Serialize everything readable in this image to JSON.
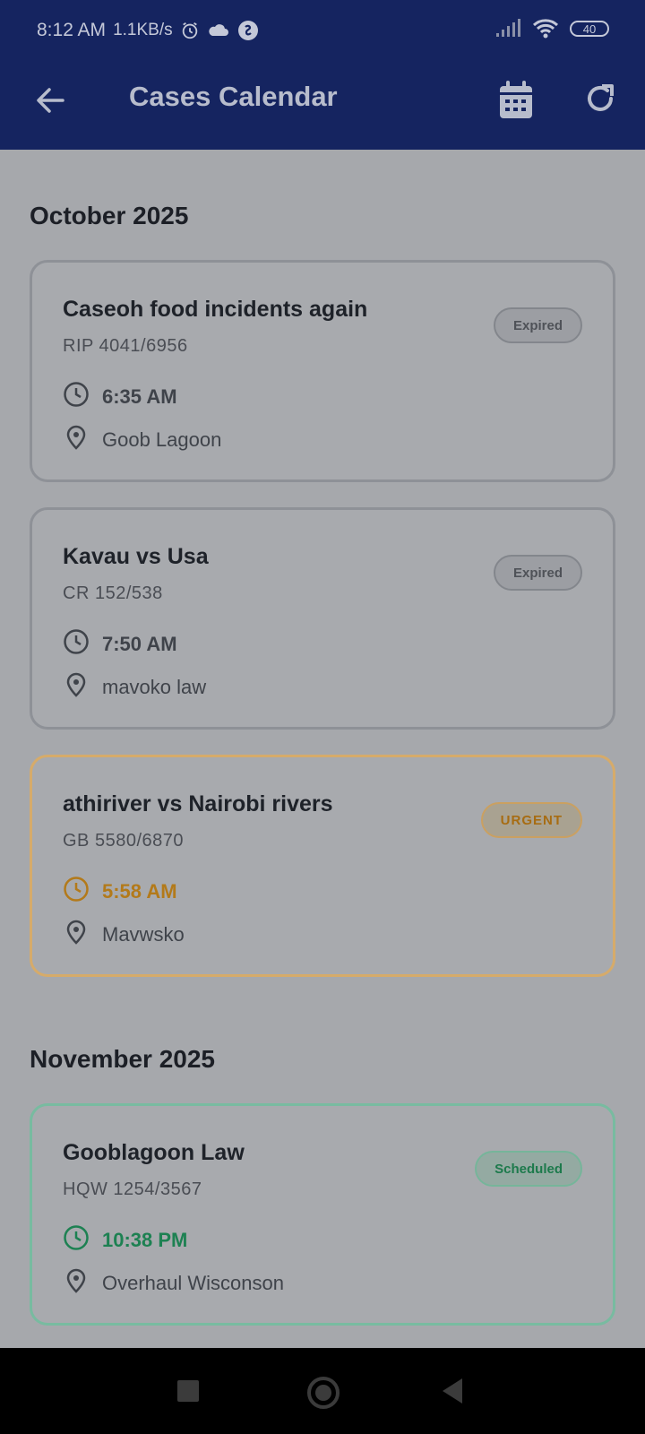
{
  "status": {
    "time": "8:12 AM",
    "speed": "1.1KB/s",
    "battery": "40",
    "icons": [
      "alarm-icon",
      "cloud-icon",
      "shazam-icon",
      "signal-icon",
      "wifi-icon",
      "battery-icon"
    ]
  },
  "appbar": {
    "title": "Cases Calendar",
    "icons": [
      "back-arrow-icon",
      "calendar-icon",
      "refresh-icon"
    ],
    "color": "#152460"
  },
  "sections": [
    {
      "month": "October 2025",
      "cases": [
        {
          "title": "Caseoh food incidents again",
          "number": "RIP 4041/6956",
          "time": "6:35 AM",
          "location": "Goob Lagoon",
          "status": "Expired"
        },
        {
          "title": "Kavau vs Usa",
          "number": "CR 152/538",
          "time": "7:50 AM",
          "location": "mavoko law",
          "status": "Expired"
        },
        {
          "title": "athiriver vs Nairobi rivers",
          "number": "GB 5580/6870",
          "time": "5:58 AM",
          "location": "Mavwsko",
          "status": "URGENT"
        }
      ]
    },
    {
      "month": "November 2025",
      "cases": [
        {
          "title": "Gooblagoon Law",
          "number": "HQW 1254/3567",
          "time": "10:38 PM",
          "location": "Overhaul Wisconson",
          "status": "Scheduled"
        }
      ]
    }
  ],
  "colors": {
    "expired": "#83868c",
    "urgent": "#b37a1a",
    "scheduled": "#1d8152"
  }
}
